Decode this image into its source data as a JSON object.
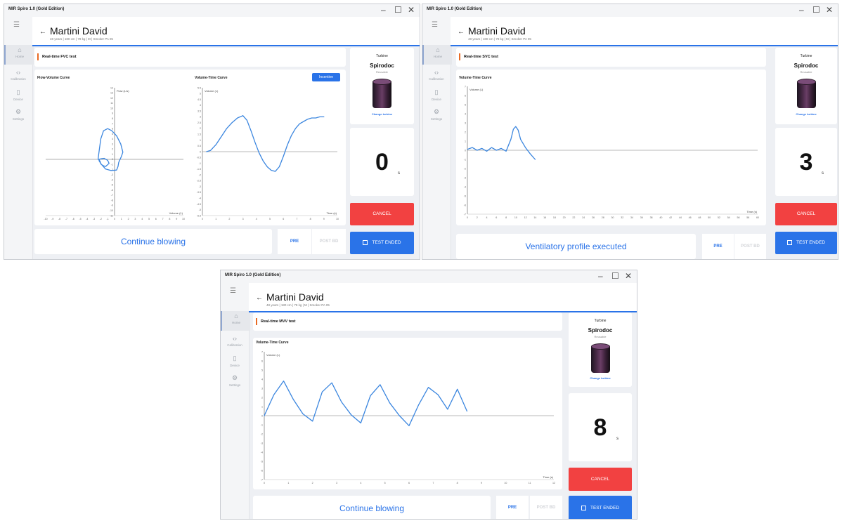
{
  "app_title": "MIR Spiro 1.0 (Gold Edition)",
  "window_controls": {
    "minimize": "–",
    "maximize": "☐",
    "close": "✕"
  },
  "sidebar": {
    "items": [
      {
        "label": "Home",
        "icon": "home-icon",
        "glyph": "⌂"
      },
      {
        "label": "Calibration",
        "icon": "code-icon",
        "glyph": "‹›"
      },
      {
        "label": "Device",
        "icon": "device-icon",
        "glyph": "▯"
      },
      {
        "label": "Settings",
        "icon": "gear-icon",
        "glyph": "⚙"
      }
    ]
  },
  "patient": {
    "name": "Martini David",
    "info_a": "48 years | 180 cm | 78 kg | M | Smoker PA 05",
    "info_b": "48 years | 180 cm | 78 kg | M | Smoker PA 05",
    "info_c": "48 years | 180 cm | 78 kg | M | Smoker PA 05"
  },
  "turbine": {
    "heading": "Turbine",
    "name": "Spirodoc",
    "sub": "Reusable",
    "link": "Change turbine"
  },
  "buttons": {
    "cancel": "CANCEL",
    "test_ended": "TEST ENDED",
    "pre": "PRE",
    "post_bd": "POST BD",
    "incentive": "Incentive"
  },
  "fvc": {
    "title": "Real-time FVC test",
    "timer": "0",
    "unit": "s",
    "status": "Continue blowing",
    "fv_title": "Flow-Volume Curve",
    "vt_title": "Volume-Time Curve"
  },
  "svc": {
    "title": "Real-time SVC test",
    "timer": "3",
    "unit": "s",
    "status": "Ventilatory profile executed",
    "vt_title": "Volume-Time Curve"
  },
  "mvv": {
    "title": "Real-time MVV test",
    "timer": "8",
    "unit": "s",
    "status": "Continue blowing",
    "vt_title": "Volume-Time Curve"
  },
  "colors": {
    "accent": "#2a73e8",
    "cancel": "#f24141",
    "title_bar": "#e96a24",
    "curve": "#3b86df"
  },
  "chart_data": [
    {
      "id": "fvc_flow_volume",
      "type": "line",
      "title": "Flow-Volume Curve",
      "xlabel": "Volume (L)",
      "ylabel": "Flow (L/s)",
      "xlim": [
        -10,
        10
      ],
      "ylim": [
        -11,
        14
      ],
      "xticks": [
        -10,
        -9,
        -8,
        -7,
        -6,
        -5,
        -4,
        -3,
        -2,
        -1,
        0,
        1,
        2,
        3,
        4,
        5,
        6,
        7,
        8,
        9,
        10
      ],
      "yticks": [
        14,
        13,
        12,
        11,
        10,
        9,
        8,
        7,
        6,
        5,
        4,
        3,
        2,
        1,
        0,
        -1,
        -2,
        -3,
        -4,
        -5,
        -6,
        -7,
        -8,
        -9,
        -10,
        -11
      ],
      "series": [
        {
          "x": [
            -2.4,
            -2.2,
            -2.0,
            -1.6,
            -1.0,
            -0.4,
            0.3,
            0.9,
            1.2,
            1.0,
            0.6,
            0.5,
            0.3,
            -0.5,
            -1.3,
            -1.9,
            -2.2,
            -2.3,
            -2.0,
            -1.5,
            -1.0,
            -0.8,
            -1.3,
            -1.7,
            -2.0,
            -2.1,
            -2.3
          ],
          "y": [
            0.0,
            2.0,
            4.0,
            5.6,
            6.0,
            5.6,
            4.6,
            3.0,
            1.4,
            0.6,
            -0.6,
            -1.4,
            -2.1,
            -2.2,
            -1.9,
            -1.0,
            -0.4,
            0.0,
            0.1,
            0.2,
            -0.2,
            -0.8,
            -1.4,
            -1.2,
            -0.9,
            -0.4,
            0.0
          ]
        }
      ]
    },
    {
      "id": "fvc_volume_time",
      "type": "line",
      "title": "Volume-Time Curve",
      "xlabel": "Time (s)",
      "ylabel": "Volume (L)",
      "xlim": [
        0,
        10
      ],
      "ylim": [
        -5.5,
        5.5
      ],
      "xticks": [
        0,
        1,
        2,
        3,
        4,
        5,
        6,
        7,
        8,
        9,
        10
      ],
      "yticks": [
        5.5,
        5,
        4.5,
        4,
        3.5,
        3,
        2.5,
        2,
        1.5,
        1,
        0.5,
        0,
        -0.5,
        -1,
        -1.5,
        -2,
        -2.5,
        -3,
        -3.5,
        -4,
        -4.5,
        -5,
        -5.5
      ],
      "series": [
        {
          "x": [
            0.3,
            0.6,
            1.0,
            1.4,
            1.8,
            2.2,
            2.6,
            3.0,
            3.3,
            3.6,
            3.9,
            4.2,
            4.5,
            4.8,
            5.1,
            5.4,
            5.7,
            6.0,
            6.3,
            6.6,
            6.9,
            7.2,
            7.5,
            7.8,
            8.1,
            8.4,
            8.7,
            9.0
          ],
          "y": [
            0.0,
            0.1,
            0.6,
            1.3,
            2.0,
            2.5,
            2.9,
            3.1,
            2.7,
            1.8,
            0.8,
            -0.1,
            -0.8,
            -1.3,
            -1.6,
            -1.7,
            -1.3,
            -0.4,
            0.6,
            1.4,
            2.0,
            2.4,
            2.6,
            2.8,
            2.9,
            2.9,
            3.0,
            3.0
          ]
        }
      ]
    },
    {
      "id": "svc_volume_time",
      "type": "line",
      "title": "Volume-Time Curve",
      "xlabel": "Time (s)",
      "ylabel": "Volume (L)",
      "xlim": [
        0,
        60
      ],
      "ylim": [
        -7,
        7
      ],
      "xticks": [
        0,
        2,
        4,
        6,
        8,
        10,
        12,
        14,
        16,
        18,
        20,
        22,
        24,
        26,
        28,
        30,
        32,
        34,
        36,
        38,
        40,
        42,
        44,
        46,
        48,
        50,
        52,
        54,
        56,
        58,
        60
      ],
      "yticks": [
        7,
        6,
        5,
        4,
        3,
        2,
        1,
        0,
        -1,
        -2,
        -3,
        -4,
        -5,
        -6,
        -7
      ],
      "series": [
        {
          "x": [
            0,
            1,
            2,
            3,
            4,
            5,
            6,
            7,
            8,
            9,
            9.5,
            10,
            10.5,
            11,
            12,
            13,
            14
          ],
          "y": [
            0.1,
            0.3,
            0.0,
            0.2,
            -0.1,
            0.3,
            0.0,
            0.2,
            -0.1,
            1.2,
            2.3,
            2.6,
            2.2,
            1.2,
            0.3,
            -0.4,
            -1.0
          ]
        }
      ]
    },
    {
      "id": "mvv_volume_time",
      "type": "line",
      "title": "Volume-Time Curve",
      "xlabel": "Time (s)",
      "ylabel": "Volume (L)",
      "xlim": [
        0,
        12
      ],
      "ylim": [
        -7,
        7
      ],
      "xticks": [
        0,
        1,
        2,
        3,
        4,
        5,
        6,
        7,
        8,
        9,
        10,
        11,
        12
      ],
      "yticks": [
        7,
        6,
        5,
        4,
        3,
        2,
        1,
        0,
        -1,
        -2,
        -3,
        -4,
        -5,
        -6,
        -7
      ],
      "series": [
        {
          "x": [
            0,
            0.4,
            0.8,
            1.2,
            1.6,
            2.0,
            2.4,
            2.8,
            3.2,
            3.6,
            4.0,
            4.4,
            4.8,
            5.2,
            5.6,
            6.0,
            6.4,
            6.8,
            7.2,
            7.6,
            8.0,
            8.4
          ],
          "y": [
            0.0,
            2.3,
            3.8,
            1.8,
            0.2,
            -0.6,
            2.6,
            3.6,
            1.5,
            0.1,
            -0.8,
            2.2,
            3.4,
            1.4,
            0.0,
            -1.1,
            1.2,
            3.1,
            2.3,
            0.7,
            2.9,
            0.5
          ]
        }
      ]
    }
  ]
}
